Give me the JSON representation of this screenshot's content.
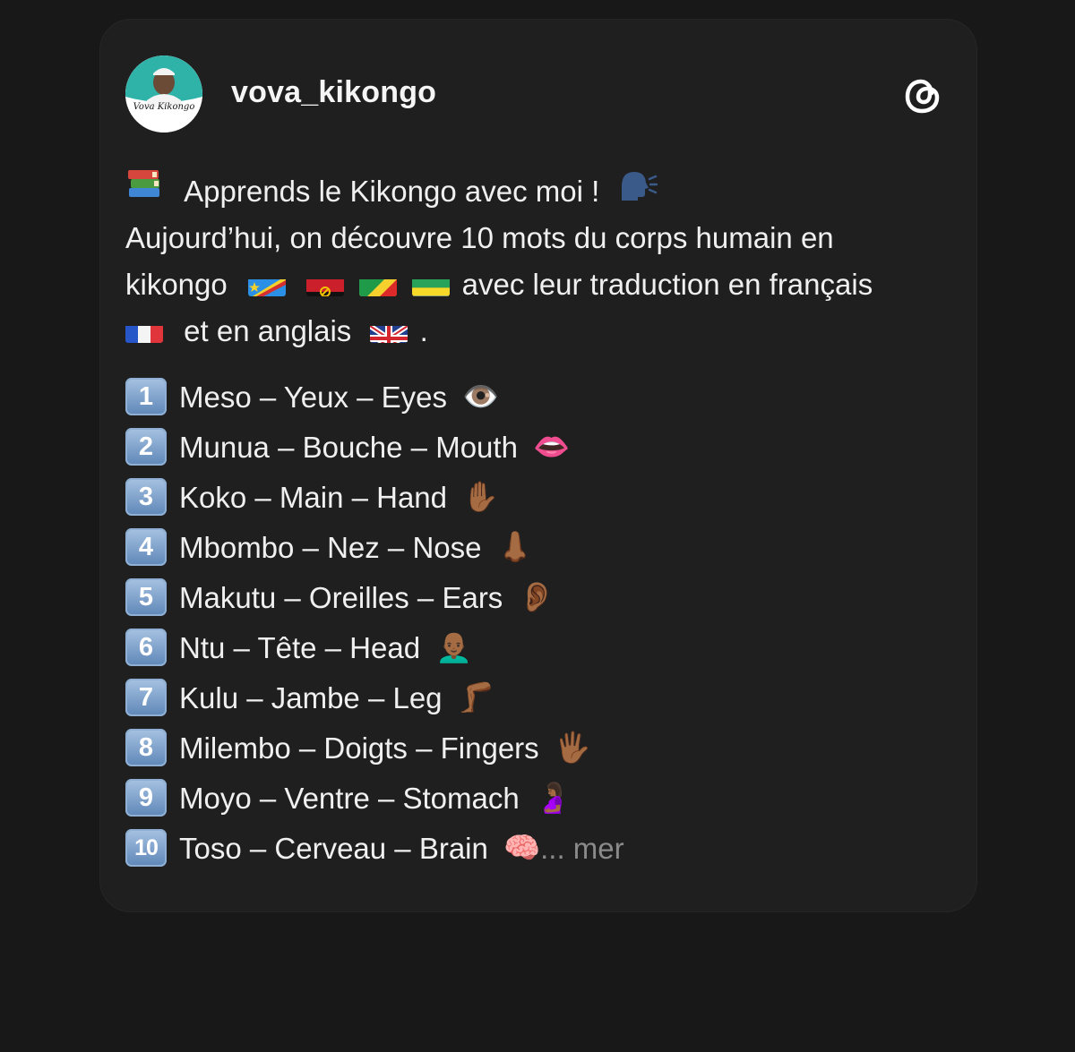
{
  "post": {
    "username": "vova_kikongo",
    "avatar_label": "Vova Kikongo",
    "intro_line1": "Apprends le Kikongo avec moi !",
    "intro_line2": "Aujourd’hui, on découvre 10 mots du corps humain en",
    "intro_line3_a": "kikongo",
    "intro_line3_b": "avec leur traduction en français",
    "intro_line4_a": "et en anglais",
    "intro_line4_b": ".",
    "items": [
      {
        "num": "1",
        "text": "Meso – Yeux – Eyes",
        "emoji": "👁️"
      },
      {
        "num": "2",
        "text": "Munua – Bouche – Mouth",
        "emoji": "👄"
      },
      {
        "num": "3",
        "text": "Koko – Main – Hand",
        "emoji": "✋🏾"
      },
      {
        "num": "4",
        "text": "Mbombo – Nez – Nose",
        "emoji": "👃🏾"
      },
      {
        "num": "5",
        "text": "Makutu – Oreilles – Ears",
        "emoji": "👂🏾"
      },
      {
        "num": "6",
        "text": "Ntu – Tête – Head",
        "emoji": "👨🏾‍🦲"
      },
      {
        "num": "7",
        "text": "Kulu – Jambe – Leg",
        "emoji": "🦵🏾"
      },
      {
        "num": "8",
        "text": "Milembo – Doigts – Fingers",
        "emoji": "🖐🏾"
      },
      {
        "num": "9",
        "text": "Moyo – Ventre – Stomach",
        "emoji": "🤰🏾"
      },
      {
        "num": "10",
        "text": "Toso – Cerveau – Brain",
        "emoji": "🧠"
      }
    ],
    "more_label": "... mer"
  },
  "icons": {
    "threads": "threads-logo-icon",
    "books": "books-icon",
    "speaking_head": "speaking-head-icon"
  },
  "colors": {
    "background": "#181818",
    "card": "#1f1f1f",
    "text": "#f0f0f0",
    "muted": "#8a8a8a",
    "badge": "#7fa3cf"
  }
}
